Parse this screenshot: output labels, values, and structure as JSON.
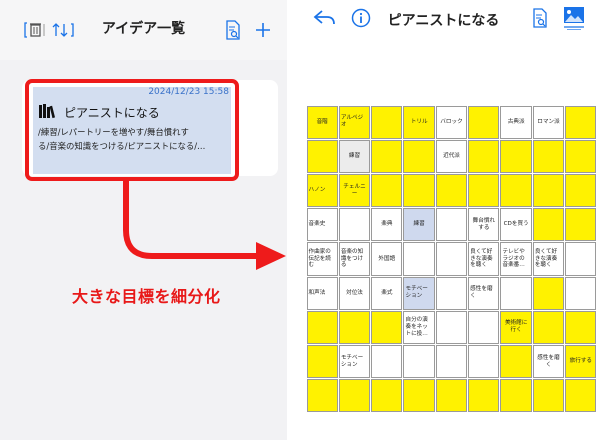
{
  "colors": {
    "accent_blue": "#1a73e8",
    "caption_red": "#e81818",
    "highlight_red": "#ee1b1b",
    "cell_yellow": "#fff200",
    "cell_gray": "#ececec",
    "cell_blue": "#cfd9ee",
    "cell_pink": "#f7cccc"
  },
  "left_screen": {
    "title": "アイデア一覧",
    "toolbar_icons": [
      "trash-icon",
      "sort-icon",
      "search-document-icon",
      "plus-icon"
    ],
    "card": {
      "date": "2024/12/23 15:58",
      "icon": "books-icon",
      "title": "ピアニストになる",
      "line1": "/練習/レパートリーを増やす/舞台慣れす",
      "line2": "る/音楽の知識をつける/ピアニストになる/…"
    },
    "caption": "大きな目標を細分化"
  },
  "right_screen": {
    "title": "ピアニストになる",
    "toolbar_icons": [
      "back-icon",
      "info-icon",
      "search-document-icon",
      "image-icon"
    ],
    "grid": [
      [
        {
          "text": "音階",
          "cls": "y"
        },
        {
          "text": "アルペジオ",
          "cls": "y left"
        },
        {
          "text": "",
          "cls": "y"
        },
        {
          "text": "トリル",
          "cls": "y"
        },
        {
          "text": "バロック",
          "cls": "w"
        },
        {
          "text": "",
          "cls": "y"
        },
        {
          "text": "古典派",
          "cls": "w"
        },
        {
          "text": "ロマン派",
          "cls": "w"
        },
        {
          "text": "",
          "cls": "y"
        }
      ],
      [
        {
          "text": "",
          "cls": "y"
        },
        {
          "text": "練習",
          "cls": "g"
        },
        {
          "text": "",
          "cls": "y"
        },
        {
          "text": "",
          "cls": "y"
        },
        {
          "text": "近代派",
          "cls": "w"
        },
        {
          "text": "",
          "cls": "y"
        },
        {
          "text": "",
          "cls": "y"
        },
        {
          "text": "",
          "cls": "y"
        },
        {
          "text": "",
          "cls": "y"
        }
      ],
      [
        {
          "text": "ハノン",
          "cls": "y left"
        },
        {
          "text": "チェルニー",
          "cls": "y"
        },
        {
          "text": "",
          "cls": "y"
        },
        {
          "text": "",
          "cls": "y"
        },
        {
          "text": "",
          "cls": "y"
        },
        {
          "text": "",
          "cls": "y"
        },
        {
          "text": "",
          "cls": "y"
        },
        {
          "text": "",
          "cls": "y"
        },
        {
          "text": "",
          "cls": "y"
        }
      ],
      [
        {
          "text": "音楽史",
          "cls": "w left"
        },
        {
          "text": "",
          "cls": "w"
        },
        {
          "text": "楽典",
          "cls": "w"
        },
        {
          "text": "練習",
          "cls": "b"
        },
        {
          "text": "",
          "cls": "w"
        },
        {
          "text": "舞台慣れする",
          "cls": "w"
        },
        {
          "text": "CDを買う",
          "cls": "w"
        },
        {
          "text": "",
          "cls": "y"
        },
        {
          "text": "",
          "cls": "y"
        }
      ],
      [
        {
          "text": "作曲家の伝記を読む",
          "cls": "w left"
        },
        {
          "text": "音楽の知識をつける",
          "cls": "w left"
        },
        {
          "text": "外国語",
          "cls": "w"
        },
        {
          "text": "",
          "cls": "w"
        },
        {
          "text": "",
          "cls": "w"
        },
        {
          "text": "良くて好きな演奏を聴く",
          "cls": "w left"
        },
        {
          "text": "テレビやラジオの音楽番…",
          "cls": "w left"
        },
        {
          "text": "良くて好きな演奏を聴く",
          "cls": "w left"
        },
        {
          "text": "",
          "cls": "w"
        }
      ],
      [
        {
          "text": "和声法",
          "cls": "w left"
        },
        {
          "text": "対位法",
          "cls": "w"
        },
        {
          "text": "楽式",
          "cls": "w"
        },
        {
          "text": "モチベーション",
          "cls": "b left"
        },
        {
          "text": "",
          "cls": "w"
        },
        {
          "text": "感性を磨く",
          "cls": "w left"
        },
        {
          "text": "",
          "cls": "w"
        },
        {
          "text": "",
          "cls": "y"
        },
        {
          "text": "",
          "cls": "w"
        }
      ],
      [
        {
          "text": "",
          "cls": "y"
        },
        {
          "text": "",
          "cls": "y"
        },
        {
          "text": "",
          "cls": "y"
        },
        {
          "text": "自分の演奏をネットに投…",
          "cls": "w left"
        },
        {
          "text": "",
          "cls": "w"
        },
        {
          "text": "",
          "cls": "w"
        },
        {
          "text": "美術館に行く",
          "cls": "y"
        },
        {
          "text": "",
          "cls": "y"
        },
        {
          "text": "",
          "cls": "y"
        }
      ],
      [
        {
          "text": "",
          "cls": "y"
        },
        {
          "text": "モチベーション",
          "cls": "w left"
        },
        {
          "text": "",
          "cls": "w"
        },
        {
          "text": "",
          "cls": "w"
        },
        {
          "text": "",
          "cls": "w"
        },
        {
          "text": "",
          "cls": "w"
        },
        {
          "text": "",
          "cls": "y"
        },
        {
          "text": "感性を磨く",
          "cls": "w"
        },
        {
          "text": "旅行する",
          "cls": "y"
        }
      ],
      [
        {
          "text": "",
          "cls": "y"
        },
        {
          "text": "",
          "cls": "y"
        },
        {
          "text": "",
          "cls": "y"
        },
        {
          "text": "",
          "cls": "y"
        },
        {
          "text": "",
          "cls": "y"
        },
        {
          "text": "",
          "cls": "y"
        },
        {
          "text": "",
          "cls": "y"
        },
        {
          "text": "",
          "cls": "y"
        },
        {
          "text": "",
          "cls": "y"
        }
      ]
    ]
  }
}
